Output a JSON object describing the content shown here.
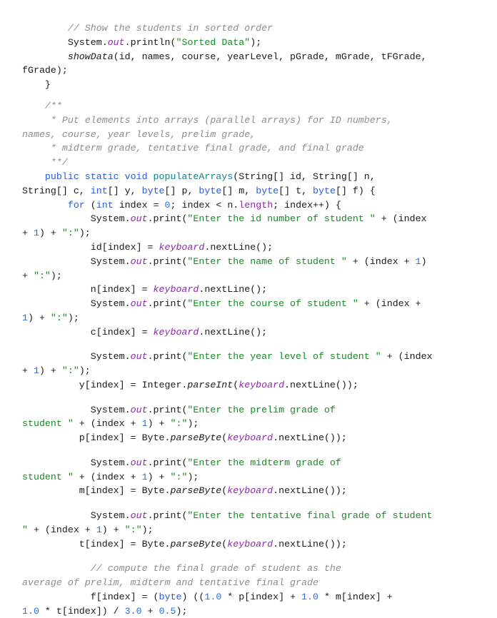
{
  "document": {
    "language": "java",
    "lines": [
      [
        {
          "t": "        "
        },
        {
          "t": "// Show the students in sorted order",
          "c": "cm"
        }
      ],
      [
        {
          "t": "        System."
        },
        {
          "t": "out",
          "c": "fld"
        },
        {
          "t": ".println("
        },
        {
          "t": "\"Sorted Data\"",
          "c": "str"
        },
        {
          "t": ");"
        }
      ],
      [
        {
          "t": "        "
        },
        {
          "t": "showData",
          "c": "it"
        },
        {
          "t": "(id, names, course, yearLevel, pGrade, mGrade, tFGrade,"
        }
      ],
      [
        {
          "t": "fGrade);"
        }
      ],
      [
        {
          "t": "    }"
        }
      ],
      [
        {
          "t": ""
        }
      ],
      [
        {
          "t": "    "
        },
        {
          "t": "/**",
          "c": "cm"
        }
      ],
      [
        {
          "t": "     "
        },
        {
          "t": "* Put elements into arrays (parallel arrays) for ID numbers,",
          "c": "cm"
        }
      ],
      [
        {
          "t": "names, course, year levels, prelim grade,",
          "c": "cm"
        }
      ],
      [
        {
          "t": "     "
        },
        {
          "t": "* midterm grade, tentative final grade, and final grade",
          "c": "cm"
        }
      ],
      [
        {
          "t": "     "
        },
        {
          "t": "**/",
          "c": "cm"
        }
      ],
      [
        {
          "t": "    "
        },
        {
          "t": "public static void ",
          "c": "kw"
        },
        {
          "t": "populateArrays",
          "c": "mth"
        },
        {
          "t": "(String[] id, String[] n,"
        }
      ],
      [
        {
          "t": "String[] c, "
        },
        {
          "t": "int",
          "c": "kw"
        },
        {
          "t": "[] y, "
        },
        {
          "t": "byte",
          "c": "kw"
        },
        {
          "t": "[] p, "
        },
        {
          "t": "byte",
          "c": "kw"
        },
        {
          "t": "[] m, "
        },
        {
          "t": "byte",
          "c": "kw"
        },
        {
          "t": "[] t, "
        },
        {
          "t": "byte",
          "c": "kw"
        },
        {
          "t": "[] f) {"
        }
      ],
      [
        {
          "t": "        "
        },
        {
          "t": "for",
          "c": "kw"
        },
        {
          "t": " ("
        },
        {
          "t": "int",
          "c": "kw"
        },
        {
          "t": " index = "
        },
        {
          "t": "0",
          "c": "num"
        },
        {
          "t": "; index < n."
        },
        {
          "t": "length",
          "c": "fld-n"
        },
        {
          "t": "; index++) {"
        }
      ],
      [
        {
          "t": "            System."
        },
        {
          "t": "out",
          "c": "fld"
        },
        {
          "t": ".print("
        },
        {
          "t": "\"Enter the id number of student \"",
          "c": "str"
        },
        {
          "t": " + (index"
        }
      ],
      [
        {
          "t": "+ "
        },
        {
          "t": "1",
          "c": "num"
        },
        {
          "t": ") + "
        },
        {
          "t": "\":\"",
          "c": "str"
        },
        {
          "t": ");"
        }
      ],
      [
        {
          "t": "            id[index] = "
        },
        {
          "t": "keyboard",
          "c": "fld"
        },
        {
          "t": ".nextLine();"
        }
      ],
      [
        {
          "t": "            System."
        },
        {
          "t": "out",
          "c": "fld"
        },
        {
          "t": ".print("
        },
        {
          "t": "\"Enter the name of student \"",
          "c": "str"
        },
        {
          "t": " + (index + "
        },
        {
          "t": "1",
          "c": "num"
        },
        {
          "t": ")"
        }
      ],
      [
        {
          "t": "+ "
        },
        {
          "t": "\":\"",
          "c": "str"
        },
        {
          "t": ");"
        }
      ],
      [
        {
          "t": "            n[index] = "
        },
        {
          "t": "keyboard",
          "c": "fld"
        },
        {
          "t": ".nextLine();"
        }
      ],
      [
        {
          "t": "            System."
        },
        {
          "t": "out",
          "c": "fld"
        },
        {
          "t": ".print("
        },
        {
          "t": "\"Enter the course of student \"",
          "c": "str"
        },
        {
          "t": " + (index +"
        }
      ],
      [
        {
          "t": "1",
          "c": "num"
        },
        {
          "t": ") + "
        },
        {
          "t": "\":\"",
          "c": "str"
        },
        {
          "t": ");"
        }
      ],
      [
        {
          "t": "            c[index] = "
        },
        {
          "t": "keyboard",
          "c": "fld"
        },
        {
          "t": ".nextLine();"
        }
      ],
      [
        {
          "t": ""
        }
      ],
      [
        {
          "t": "            System."
        },
        {
          "t": "out",
          "c": "fld"
        },
        {
          "t": ".print("
        },
        {
          "t": "\"Enter the year level of student \"",
          "c": "str"
        },
        {
          "t": " + (index"
        }
      ],
      [
        {
          "t": "+ "
        },
        {
          "t": "1",
          "c": "num"
        },
        {
          "t": ") + "
        },
        {
          "t": "\":\"",
          "c": "str"
        },
        {
          "t": ");"
        }
      ],
      [
        {
          "t": "          y[index] = Integer."
        },
        {
          "t": "parseInt",
          "c": "it"
        },
        {
          "t": "("
        },
        {
          "t": "keyboard",
          "c": "fld"
        },
        {
          "t": ".nextLine());"
        }
      ],
      [
        {
          "t": ""
        }
      ],
      [
        {
          "t": "            System."
        },
        {
          "t": "out",
          "c": "fld"
        },
        {
          "t": ".print("
        },
        {
          "t": "\"Enter the prelim grade of",
          "c": "str"
        }
      ],
      [
        {
          "t": "student \"",
          "c": "str"
        },
        {
          "t": " + (index + "
        },
        {
          "t": "1",
          "c": "num"
        },
        {
          "t": ") + "
        },
        {
          "t": "\":\"",
          "c": "str"
        },
        {
          "t": ");"
        }
      ],
      [
        {
          "t": "          p[index] = Byte."
        },
        {
          "t": "parseByte",
          "c": "it"
        },
        {
          "t": "("
        },
        {
          "t": "keyboard",
          "c": "fld"
        },
        {
          "t": ".nextLine());"
        }
      ],
      [
        {
          "t": ""
        }
      ],
      [
        {
          "t": "            System."
        },
        {
          "t": "out",
          "c": "fld"
        },
        {
          "t": ".print("
        },
        {
          "t": "\"Enter the midterm grade of",
          "c": "str"
        }
      ],
      [
        {
          "t": "student \"",
          "c": "str"
        },
        {
          "t": " + (index + "
        },
        {
          "t": "1",
          "c": "num"
        },
        {
          "t": ") + "
        },
        {
          "t": "\":\"",
          "c": "str"
        },
        {
          "t": ");"
        }
      ],
      [
        {
          "t": "          m[index] = Byte."
        },
        {
          "t": "parseByte",
          "c": "it"
        },
        {
          "t": "("
        },
        {
          "t": "keyboard",
          "c": "fld"
        },
        {
          "t": ".nextLine());"
        }
      ],
      [
        {
          "t": ""
        }
      ],
      [
        {
          "t": "            System."
        },
        {
          "t": "out",
          "c": "fld"
        },
        {
          "t": ".print("
        },
        {
          "t": "\"Enter the tentative final grade of student",
          "c": "str"
        }
      ],
      [
        {
          "t": "\"",
          "c": "str"
        },
        {
          "t": " + (index + "
        },
        {
          "t": "1",
          "c": "num"
        },
        {
          "t": ") + "
        },
        {
          "t": "\":\"",
          "c": "str"
        },
        {
          "t": ");"
        }
      ],
      [
        {
          "t": "          t[index] = Byte."
        },
        {
          "t": "parseByte",
          "c": "it"
        },
        {
          "t": "("
        },
        {
          "t": "keyboard",
          "c": "fld"
        },
        {
          "t": ".nextLine());"
        }
      ],
      [
        {
          "t": ""
        }
      ],
      [
        {
          "t": "            "
        },
        {
          "t": "// compute the final grade of student as the",
          "c": "cm"
        }
      ],
      [
        {
          "t": "average of prelim, midterm and tentative final grade",
          "c": "cm"
        }
      ],
      [
        {
          "t": "            f[index] = ("
        },
        {
          "t": "byte",
          "c": "kw"
        },
        {
          "t": ") (("
        },
        {
          "t": "1.0",
          "c": "num"
        },
        {
          "t": " * p[index] + "
        },
        {
          "t": "1.0",
          "c": "num"
        },
        {
          "t": " * m[index] +"
        }
      ],
      [
        {
          "t": "1.0",
          "c": "num"
        },
        {
          "t": " * t[index]) / "
        },
        {
          "t": "3.0",
          "c": "num"
        },
        {
          "t": " + "
        },
        {
          "t": "0.5",
          "c": "num"
        },
        {
          "t": ");"
        }
      ]
    ]
  }
}
